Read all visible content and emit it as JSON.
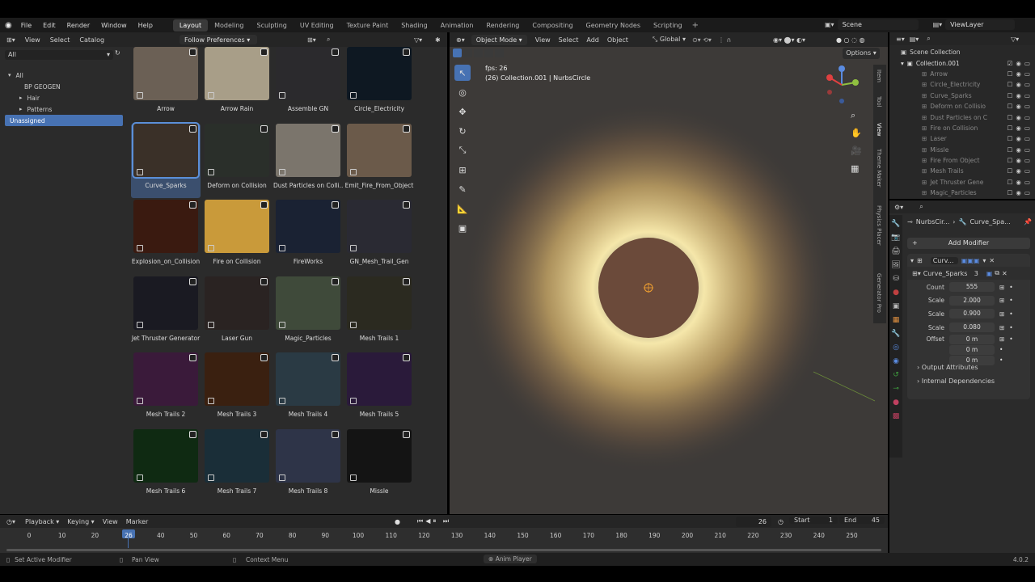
{
  "menu": [
    "File",
    "Edit",
    "Render",
    "Window",
    "Help"
  ],
  "workspaces": [
    "Layout",
    "Modeling",
    "Sculpting",
    "UV Editing",
    "Texture Paint",
    "Shading",
    "Animation",
    "Rendering",
    "Compositing",
    "Geometry Nodes",
    "Scripting"
  ],
  "active_workspace": "Layout",
  "scene": "Scene",
  "view_layer": "ViewLayer",
  "asset_browser": {
    "menus": [
      "View",
      "Select",
      "Catalog"
    ],
    "filter": "Follow Preferences",
    "library": "All",
    "catalog": [
      {
        "label": "All",
        "level": 0
      },
      {
        "label": "BP GEOGEN",
        "level": 1
      },
      {
        "label": "Hair",
        "level": 1
      },
      {
        "label": "Patterns",
        "level": 1
      },
      {
        "label": "Unassigned",
        "level": 0
      }
    ],
    "assets": [
      {
        "name": "Arrow",
        "color": "#6b6055"
      },
      {
        "name": "Arrow Rain",
        "color": "#a89e88"
      },
      {
        "name": "Assemble GN",
        "color": "#2b2a2d"
      },
      {
        "name": "Circle_Electricity",
        "color": "#0e1822"
      },
      {
        "name": "Curve_Sparks",
        "color": "#3a3028"
      },
      {
        "name": "Deform on Collision",
        "color": "#2a2f2a"
      },
      {
        "name": "Dust Particles on Colli...",
        "color": "#7b756c"
      },
      {
        "name": "Emit_Fire_From_Object",
        "color": "#6b5a4a"
      },
      {
        "name": "Explosion_on_Collision",
        "color": "#3a1a10"
      },
      {
        "name": "Fire on Collision",
        "color": "#c99a3a"
      },
      {
        "name": "FireWorks",
        "color": "#1a2233"
      },
      {
        "name": "GN_Mesh_Trail_Gen",
        "color": "#2a2a33"
      },
      {
        "name": "Jet Thruster Generator",
        "color": "#1a1a22"
      },
      {
        "name": "Laser Gun",
        "color": "#2a2322"
      },
      {
        "name": "Magic_Particles",
        "color": "#3f4a3a"
      },
      {
        "name": "Mesh Trails 1",
        "color": "#2b2a20"
      },
      {
        "name": "Mesh Trails 2",
        "color": "#3a1a3a"
      },
      {
        "name": "Mesh Trails 3",
        "color": "#3a2010"
      },
      {
        "name": "Mesh Trails 4",
        "color": "#2a3a44"
      },
      {
        "name": "Mesh Trails 5",
        "color": "#2a1a3a"
      },
      {
        "name": "Mesh Trails 6",
        "color": "#0f2a12"
      },
      {
        "name": "Mesh Trails 7",
        "color": "#1a2e38"
      },
      {
        "name": "Mesh Trails 8",
        "color": "#2e3448"
      },
      {
        "name": "Missle",
        "color": "#141414"
      }
    ]
  },
  "viewport": {
    "mode": "Object Mode",
    "menus": [
      "View",
      "Select",
      "Add",
      "Object"
    ],
    "orientation": "Global",
    "options": "Options",
    "fps": "fps: 26",
    "info": "(26) Collection.001 | NurbsCircle",
    "side_tabs": [
      "Item",
      "Tool",
      "View",
      "Theme Maker",
      "Physics Placer",
      "Generator Pro"
    ]
  },
  "outliner": {
    "root": "Scene Collection",
    "collection": "Collection.001",
    "items": [
      "Arrow",
      "Circle_Electricity",
      "Curve_Sparks",
      "Deform on Collisio",
      "Dust Particles on C",
      "Fire on Collision",
      "Laser",
      "Missle",
      "Fire From Object",
      "Mesh Trails",
      "Jet Thruster Gene",
      "Magic_Particles"
    ]
  },
  "properties": {
    "breadcrumb_obj": "NurbsCir...",
    "breadcrumb_mod": "Curve_Spa...",
    "add_modifier": "Add Modifier",
    "modifier_name": "Curv...",
    "node_group": "Curve_Sparks",
    "node_users": "3",
    "rows": [
      {
        "label": "Count",
        "value": "555"
      },
      {
        "label": "Scale",
        "value": "2.000"
      },
      {
        "label": "Scale",
        "value": "0.900"
      },
      {
        "label": "Scale",
        "value": "0.080"
      },
      {
        "label": "Offset",
        "value": "0 m"
      },
      {
        "label": "",
        "value": "0 m"
      },
      {
        "label": "",
        "value": "0 m"
      }
    ],
    "sections": [
      "Output Attributes",
      "Internal Dependencies"
    ]
  },
  "timeline": {
    "menus": [
      "Playback",
      "Keying",
      "View",
      "Marker"
    ],
    "current_frame": "26",
    "start_label": "Start",
    "start": "1",
    "end_label": "End",
    "end": "45",
    "ticks": [
      "0",
      "10",
      "20",
      "26",
      "40",
      "50",
      "60",
      "70",
      "80",
      "90",
      "100",
      "110",
      "120",
      "130",
      "140",
      "150",
      "160",
      "170",
      "180",
      "190",
      "200",
      "210",
      "220",
      "230",
      "240",
      "250"
    ]
  },
  "status": {
    "left": "Set Active Modifier",
    "mid": "Pan View",
    "ctx": "Context Menu",
    "center": "Anim Player",
    "version": "4.0.2"
  }
}
